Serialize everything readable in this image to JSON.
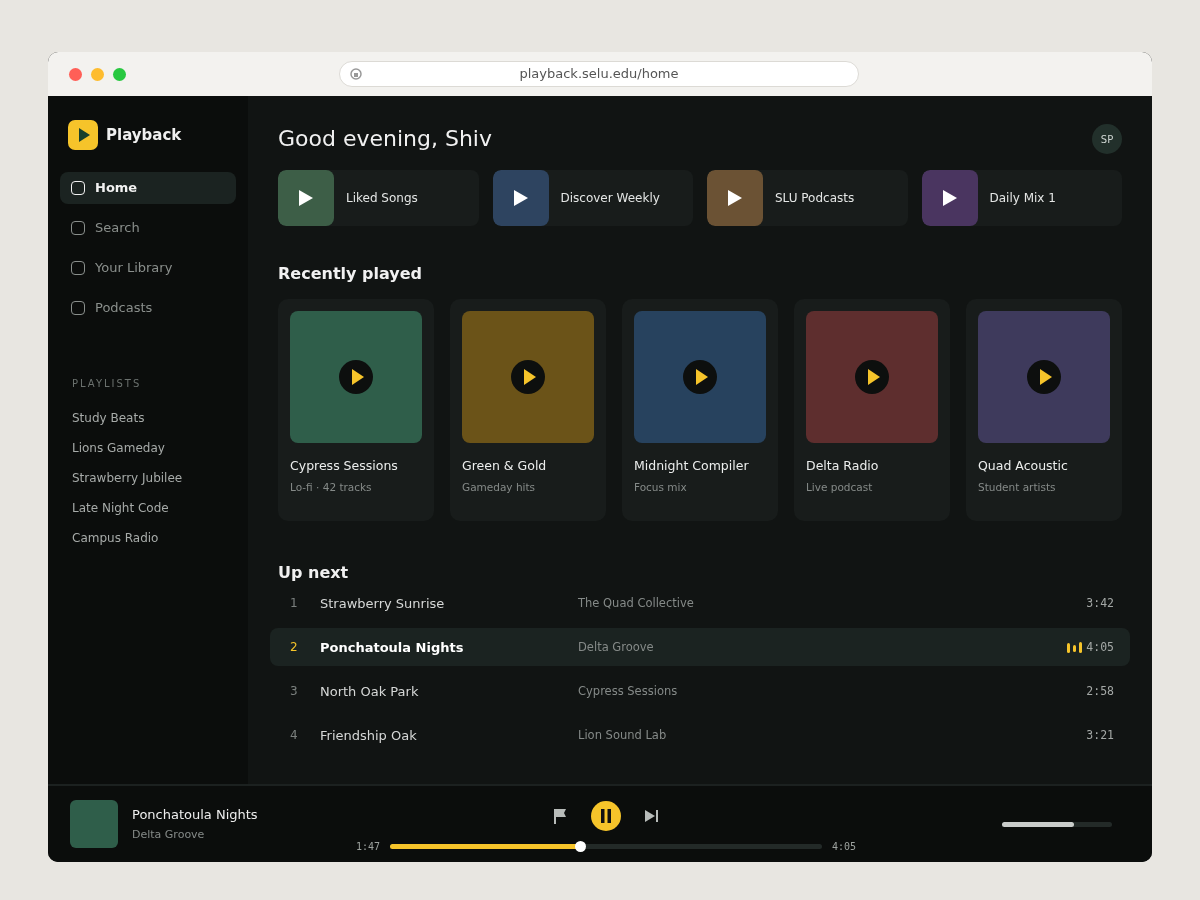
{
  "browser": {
    "url": "playback.selu.edu/home"
  },
  "sidebar": {
    "logo": "Playback",
    "nav": [
      {
        "label": "Home",
        "selected": true
      },
      {
        "label": "Search",
        "selected": false
      },
      {
        "label": "Your Library",
        "selected": false
      },
      {
        "label": "Podcasts",
        "selected": false
      }
    ],
    "playlists_heading": "PLAYLISTS",
    "playlists": [
      "Study Beats",
      "Lions Gameday",
      "Strawberry Jubilee",
      "Late Night Code",
      "Campus Radio"
    ]
  },
  "header": {
    "greeting": "Good evening, Shiv",
    "avatar": "SP"
  },
  "quick_picks": [
    {
      "label": "Liked Songs",
      "color": "#3d5e47"
    },
    {
      "label": "Discover Weekly",
      "color": "#2e4460"
    },
    {
      "label": "SLU Podcasts",
      "color": "#6b5234"
    },
    {
      "label": "Daily Mix 1",
      "color": "#4a3560"
    }
  ],
  "recently_played": {
    "title": "Recently played",
    "cards": [
      {
        "title": "Cypress Sessions",
        "subtitle": "Lo-fi · 42 tracks",
        "color": "#2f5e4a"
      },
      {
        "title": "Green & Gold",
        "subtitle": "Gameday hits",
        "color": "#6b5318"
      },
      {
        "title": "Midnight Compiler",
        "subtitle": "Focus mix",
        "color": "#27425e"
      },
      {
        "title": "Delta Radio",
        "subtitle": "Live podcast",
        "color": "#5e2e2e"
      },
      {
        "title": "Quad Acoustic",
        "subtitle": "Student artists",
        "color": "#3e3a5c"
      }
    ]
  },
  "up_next": {
    "title": "Up next",
    "rows": [
      {
        "number": "1",
        "title": "Strawberry Sunrise",
        "artist": "The Quad Collective",
        "duration": "3:42",
        "selected": false
      },
      {
        "number": "2",
        "title": "Ponchatoula Nights",
        "artist": "Delta Groove",
        "duration": "4:05",
        "selected": true
      },
      {
        "number": "3",
        "title": "North Oak Park",
        "artist": "Cypress Sessions",
        "duration": "2:58",
        "selected": false
      },
      {
        "number": "4",
        "title": "Friendship Oak",
        "artist": "Lion Sound Lab",
        "duration": "3:21",
        "selected": false
      }
    ]
  },
  "player": {
    "title": "Ponchatoula Nights",
    "artist": "Delta Groove",
    "playing": true,
    "elapsed": "1:47",
    "total": "4:05",
    "progress": {
      "level": 0.44
    },
    "volume": {
      "level": 0.65
    }
  }
}
